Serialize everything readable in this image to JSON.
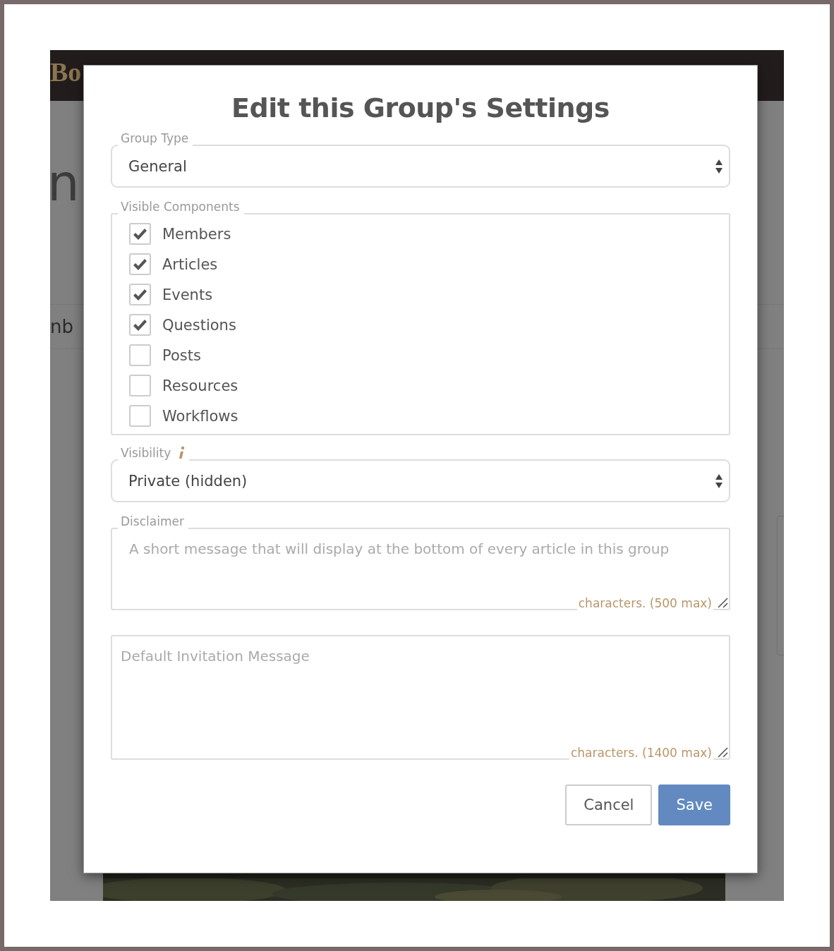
{
  "background": {
    "brand": "Bo",
    "heading_fragment": "n",
    "tab_fragment": "nb"
  },
  "dialog": {
    "title": "Edit this Group's Settings",
    "group_type": {
      "label": "Group Type",
      "value": "General"
    },
    "visible_components": {
      "label": "Visible Components",
      "items": [
        {
          "label": "Members",
          "checked": true
        },
        {
          "label": "Articles",
          "checked": true
        },
        {
          "label": "Events",
          "checked": true
        },
        {
          "label": "Questions",
          "checked": true
        },
        {
          "label": "Posts",
          "checked": false
        },
        {
          "label": "Resources",
          "checked": false
        },
        {
          "label": "Workflows",
          "checked": false
        }
      ]
    },
    "visibility": {
      "label": "Visibility",
      "value": "Private (hidden)"
    },
    "disclaimer": {
      "label": "Disclaimer",
      "placeholder": "A short message that will display at the bottom of every article in this group",
      "counter": "characters. (500 max)"
    },
    "invitation": {
      "placeholder": "Default Invitation Message",
      "counter": "characters. (1400 max)"
    },
    "buttons": [
      {
        "label": "Cancel",
        "kind": "secondary"
      },
      {
        "label": "Save",
        "kind": "primary"
      }
    ]
  }
}
